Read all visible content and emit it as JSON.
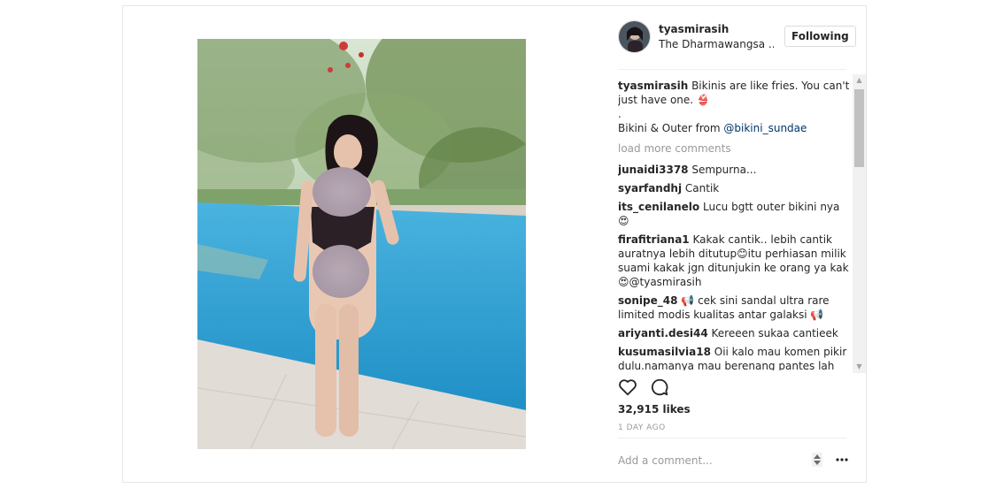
{
  "post": {
    "username": "tyasmirasih",
    "location": "The Dharmawangsa ...",
    "follow_label": "Following",
    "caption": {
      "username": "tyasmirasih",
      "line1": "Bikinis are like fries. You can't just have one. 👙",
      "line2": ".",
      "line3_prefix": "Bikini & Outer from ",
      "line3_mention": "@bikini_sundae"
    },
    "load_more": "load more comments",
    "comments": [
      {
        "user": "junaidi3378",
        "text": "Sempurna..."
      },
      {
        "user": "syarfandhj",
        "text": "Cantik"
      },
      {
        "user": "its_cenilanelo",
        "text": "Lucu bgtt outer bikini nya 😍"
      },
      {
        "user": "firafitriana1",
        "text": "Kakak cantik.. lebih cantik auratnya lebih ditutup😊itu perhiasan milik suami kakak jgn ditunjukin ke orang ya kak 😍@tyasmirasih"
      },
      {
        "user": "sonipe_48",
        "text": "📢 cek sini sandal ultra rare limited modis kualitas antar galaksi 📢"
      },
      {
        "user": "ariyanti.desi44",
        "text": "Kereeen sukaa cantieek"
      },
      {
        "user": "kusumasilvia18",
        "text": "Oii kalo mau komen pikir dulu.namanya mau berenang pantes lah pake bikini masa berenang pake kaftan"
      }
    ],
    "likes": "32,915 likes",
    "time": "1 DAY AGO",
    "add_comment_placeholder": "Add a comment..."
  },
  "icons": {
    "like": "heart-icon",
    "comment": "speech-bubble-icon",
    "more": "more-dots-icon",
    "scroll_up": "triangle-up-icon",
    "scroll_down": "triangle-down-icon"
  },
  "colors": {
    "text": "#262626",
    "muted": "#999999",
    "mention": "#003569",
    "border": "#dbdbdb",
    "pool": "#3fa9d8"
  }
}
